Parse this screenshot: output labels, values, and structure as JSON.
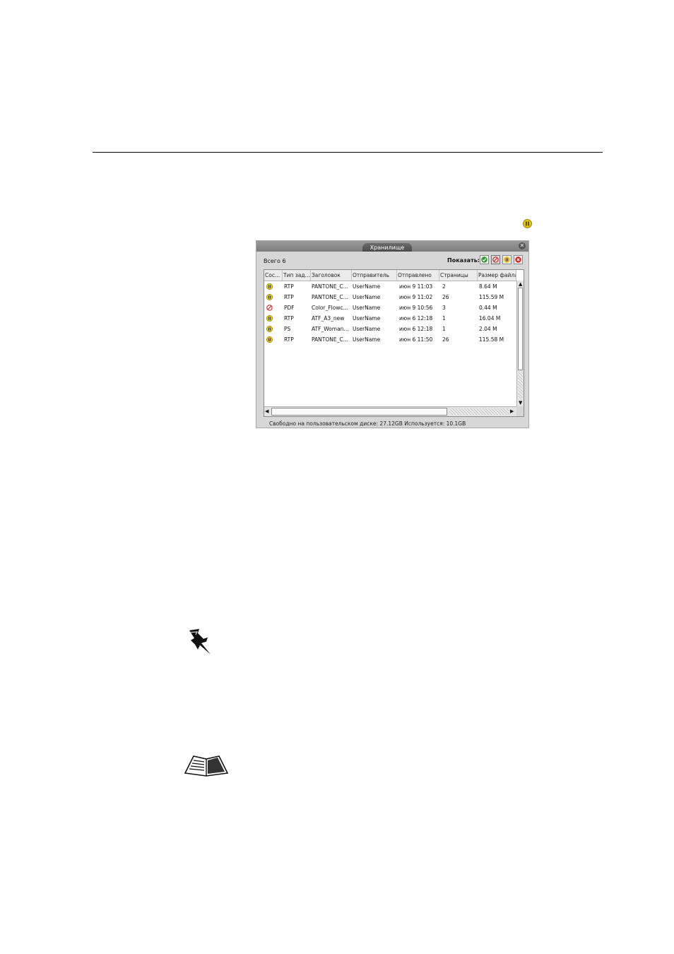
{
  "window": {
    "title": "Хранилище",
    "total": "Всего 6",
    "show_label": "Показать:"
  },
  "filters": [
    {
      "name": "completed",
      "icon": "check-icon",
      "color": "#2f9a2f"
    },
    {
      "name": "aborted",
      "icon": "prohibited-icon",
      "color": "#c8232b"
    },
    {
      "name": "held",
      "icon": "pause-icon",
      "color": "#e3c200"
    },
    {
      "name": "failed",
      "icon": "error-x-icon",
      "color": "#d42020"
    }
  ],
  "table": {
    "headers": [
      "Сос...",
      "Тип зад...",
      "Заголовок",
      "Отправитель",
      "Отправлено",
      "Страницы",
      "Размер файла"
    ],
    "rows": [
      {
        "status": "held",
        "type": "RTP",
        "title": "PANTONE_C...",
        "sender": "UserName",
        "sent": "июн 9 11:03",
        "pages": "2",
        "size": "8.64 M"
      },
      {
        "status": "held",
        "type": "RTP",
        "title": "PANTONE_C...",
        "sender": "UserName",
        "sent": "июн 9 11:02",
        "pages": "26",
        "size": "115.59 M"
      },
      {
        "status": "aborted",
        "type": "PDF",
        "title": "Color_Flowc...",
        "sender": "UserName",
        "sent": "июн 9 10:56",
        "pages": "3",
        "size": "0.44 M"
      },
      {
        "status": "held",
        "type": "RTP",
        "title": "ATF_A3_new",
        "sender": "UserName",
        "sent": "июн 6 12:18",
        "pages": "1",
        "size": "16.04 M"
      },
      {
        "status": "held",
        "type": "PS",
        "title": "ATF_Woman...",
        "sender": "UserName",
        "sent": "июн 6 12:18",
        "pages": "1",
        "size": "2.04 M"
      },
      {
        "status": "held",
        "type": "RTP",
        "title": "PANTONE_C...",
        "sender": "UserName",
        "sent": "июн 6 11:50",
        "pages": "26",
        "size": "115.58 M"
      }
    ]
  },
  "footer": {
    "status": "Свободно на пользовательском диске: 27.12GB Используется: 10.1GB"
  },
  "colors": {
    "held": "#e3c200",
    "aborted": "#c8232b",
    "panel_bg": "#d7d7d7"
  }
}
